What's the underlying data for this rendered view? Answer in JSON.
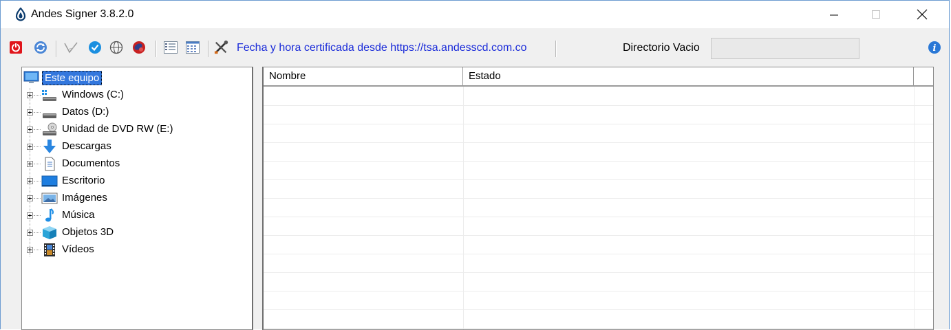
{
  "window": {
    "title": "Andes Signer 3.8.2.0"
  },
  "toolbar": {
    "icons": [
      "power-icon",
      "refresh-icon",
      "sign-check-icon",
      "verify-icon",
      "globe-icon",
      "stamp-icon",
      "list-view-icon",
      "grid-view-icon",
      "tools-icon",
      "help-icon"
    ],
    "tsa_text": "Fecha y hora certificada desde https://tsa.andesscd.com.co",
    "directory_label": "Directorio Vacio",
    "directory_value": ""
  },
  "tree": {
    "root": "Este equipo",
    "items": [
      {
        "label": "Windows (C:)",
        "icon": "windows-drive-icon"
      },
      {
        "label": "Datos (D:)",
        "icon": "drive-icon"
      },
      {
        "label": "Unidad de DVD RW (E:)",
        "icon": "dvd-drive-icon"
      },
      {
        "label": "Descargas",
        "icon": "download-arrow-icon"
      },
      {
        "label": "Documentos",
        "icon": "document-icon"
      },
      {
        "label": "Escritorio",
        "icon": "desktop-icon"
      },
      {
        "label": "Imágenes",
        "icon": "pictures-icon"
      },
      {
        "label": "Música",
        "icon": "music-note-icon"
      },
      {
        "label": "Objetos 3D",
        "icon": "cube-3d-icon"
      },
      {
        "label": "Vídeos",
        "icon": "film-icon"
      }
    ]
  },
  "list": {
    "columns": [
      "Nombre",
      "Estado"
    ],
    "rows": []
  },
  "colors": {
    "selection": "#3377dd",
    "link": "#1a2bd9",
    "window_border": "#6b9bd1"
  }
}
